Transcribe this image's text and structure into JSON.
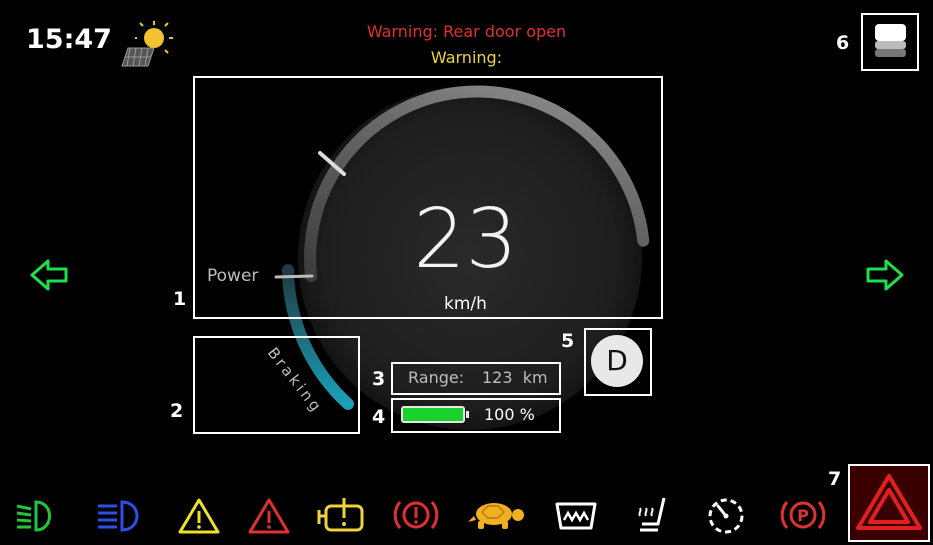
{
  "status": {
    "time": "15:47",
    "weather_icon": "solar-sun-icon"
  },
  "warnings": {
    "primary": "Warning: Rear door open",
    "secondary": "Warning:"
  },
  "speedometer": {
    "speed": "23",
    "unit": "km/h",
    "power_label": "Power",
    "braking_label": "Braking"
  },
  "range": {
    "label": "Range:",
    "value": "123  km"
  },
  "battery": {
    "level": 100,
    "label": "100 %"
  },
  "gear": {
    "value": "D"
  },
  "callouts": [
    "1",
    "2",
    "3",
    "4",
    "5",
    "6",
    "7"
  ],
  "indicators": [
    "low-beam-icon",
    "high-beam-icon",
    "general-warning-icon",
    "hazard-warning-icon",
    "engine-warning-icon",
    "brake-warning-icon",
    "turtle-mode-icon",
    "defrost-icon",
    "seat-heater-icon",
    "speed-limiter-icon",
    "parking-brake-icon"
  ],
  "colors": {
    "turn_signal": "#1ee04a",
    "warning_red": "#e0302f",
    "warning_yellow": "#f0d23a",
    "beam_green": "#22c43a",
    "beam_blue": "#2d4ee8",
    "battery_green": "#19d32a",
    "braking_teal": "#1aa0b8"
  }
}
